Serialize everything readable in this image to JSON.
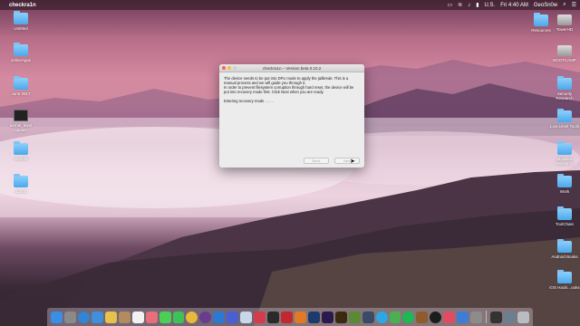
{
  "menubar": {
    "app_name": "checkra1n",
    "time": "Fri 4:40 AM",
    "user": "GeoSn0w",
    "locale": "U.S."
  },
  "desktop_left": [
    {
      "label": "Untitled",
      "kind": "folder"
    },
    {
      "label": "onlineApps",
      "kind": "folder"
    },
    {
      "label": "June 2017",
      "kind": "folder"
    },
    {
      "label": "kernel_level update",
      "kind": "terminal"
    },
    {
      "label": "Overfl0",
      "kind": "folder"
    },
    {
      "label": "iCloud",
      "kind": "folder"
    }
  ],
  "desktop_right": [
    {
      "label": "Resources",
      "kind": "folder"
    },
    {
      "label": "TowerHD",
      "kind": "drive"
    },
    {
      "label": "BOOTCAMP",
      "kind": "drive"
    },
    {
      "label": "Security Research",
      "kind": "folder"
    },
    {
      "label": "Low Level Tools",
      "kind": "folder"
    },
    {
      "label": "Malware Research",
      "kind": "folder"
    },
    {
      "label": "Work",
      "kind": "folder"
    },
    {
      "label": "ToolChain",
      "kind": "folder"
    },
    {
      "label": "Android Books",
      "kind": "folder"
    },
    {
      "label": "iOS Hacki...ooks",
      "kind": "folder"
    }
  ],
  "dialog": {
    "title": "checkra1n – Version beta 0.10.2",
    "message1": "The device needs to be put into DFU mode to apply the jailbreak. This is a manual process and we will guide you through it.",
    "message2": "In order to prevent filesystem corruption through hard reset, the device will be put into recovery mode first. Click Next when you are ready.",
    "status": "Entering recovery mode",
    "status_dots": "........",
    "back_label": "Back",
    "next_label": "Next"
  },
  "colors": {
    "folder": "#4aa8ec",
    "close": "#fc605c",
    "minimize": "#fdbc40"
  },
  "dock": [
    {
      "icon": "finder-icon",
      "color": "#3a8ee6"
    },
    {
      "icon": "launchpad-icon",
      "color": "#8a8a8a"
    },
    {
      "icon": "safari-icon",
      "color": "#2f86d8"
    },
    {
      "icon": "mail-icon",
      "color": "#3f8fdc"
    },
    {
      "icon": "notes-icon",
      "color": "#e7c14a"
    },
    {
      "icon": "contacts-icon",
      "color": "#b28b5e"
    },
    {
      "icon": "calendar-icon",
      "color": "#f2f2f2"
    },
    {
      "icon": "photos-icon",
      "color": "#e86f7a"
    },
    {
      "icon": "messages-icon",
      "color": "#4ccf57"
    },
    {
      "icon": "facetime-icon",
      "color": "#3fc255"
    },
    {
      "icon": "chrome-icon",
      "color": "#e9b93a"
    },
    {
      "icon": "github-icon",
      "color": "#6a3c8f"
    },
    {
      "icon": "xcode-icon",
      "color": "#2d79d1"
    },
    {
      "icon": "app-store-icon",
      "color": "#4a5fd6"
    },
    {
      "icon": "preview-icon",
      "color": "#c9d8e8"
    },
    {
      "icon": "photo-booth-icon",
      "color": "#d43c4b"
    },
    {
      "icon": "terminal-icon",
      "color": "#2a2a2a"
    },
    {
      "icon": "acrobat-icon",
      "color": "#c3282e"
    },
    {
      "icon": "sublime-icon",
      "color": "#e07a25"
    },
    {
      "icon": "photoshop-icon",
      "color": "#1e3a6c"
    },
    {
      "icon": "premiere-icon",
      "color": "#2b1b4d"
    },
    {
      "icon": "illustrator-icon",
      "color": "#3a2a10"
    },
    {
      "icon": "minecraft-icon",
      "color": "#5b8a34"
    },
    {
      "icon": "steam-icon",
      "color": "#3b4a66"
    },
    {
      "icon": "skype-icon",
      "color": "#2aa9e6"
    },
    {
      "icon": "evernote-icon",
      "color": "#4caf50"
    },
    {
      "icon": "spotify-icon",
      "color": "#1db954"
    },
    {
      "icon": "cydia-icon",
      "color": "#8f5a2c"
    },
    {
      "icon": "checkra1n-icon",
      "color": "#1c1c1c"
    },
    {
      "icon": "music-icon",
      "color": "#e14c62"
    },
    {
      "icon": "apple-configurator-icon",
      "color": "#3d7dd6"
    },
    {
      "icon": "system-preferences-icon",
      "color": "#8c8c8c"
    },
    {
      "icon": "activity-monitor-icon",
      "color": "#333333"
    },
    {
      "icon": "downloads-icon",
      "color": "#6b7f93"
    },
    {
      "icon": "trash-icon",
      "color": "#b9bcc0"
    }
  ]
}
